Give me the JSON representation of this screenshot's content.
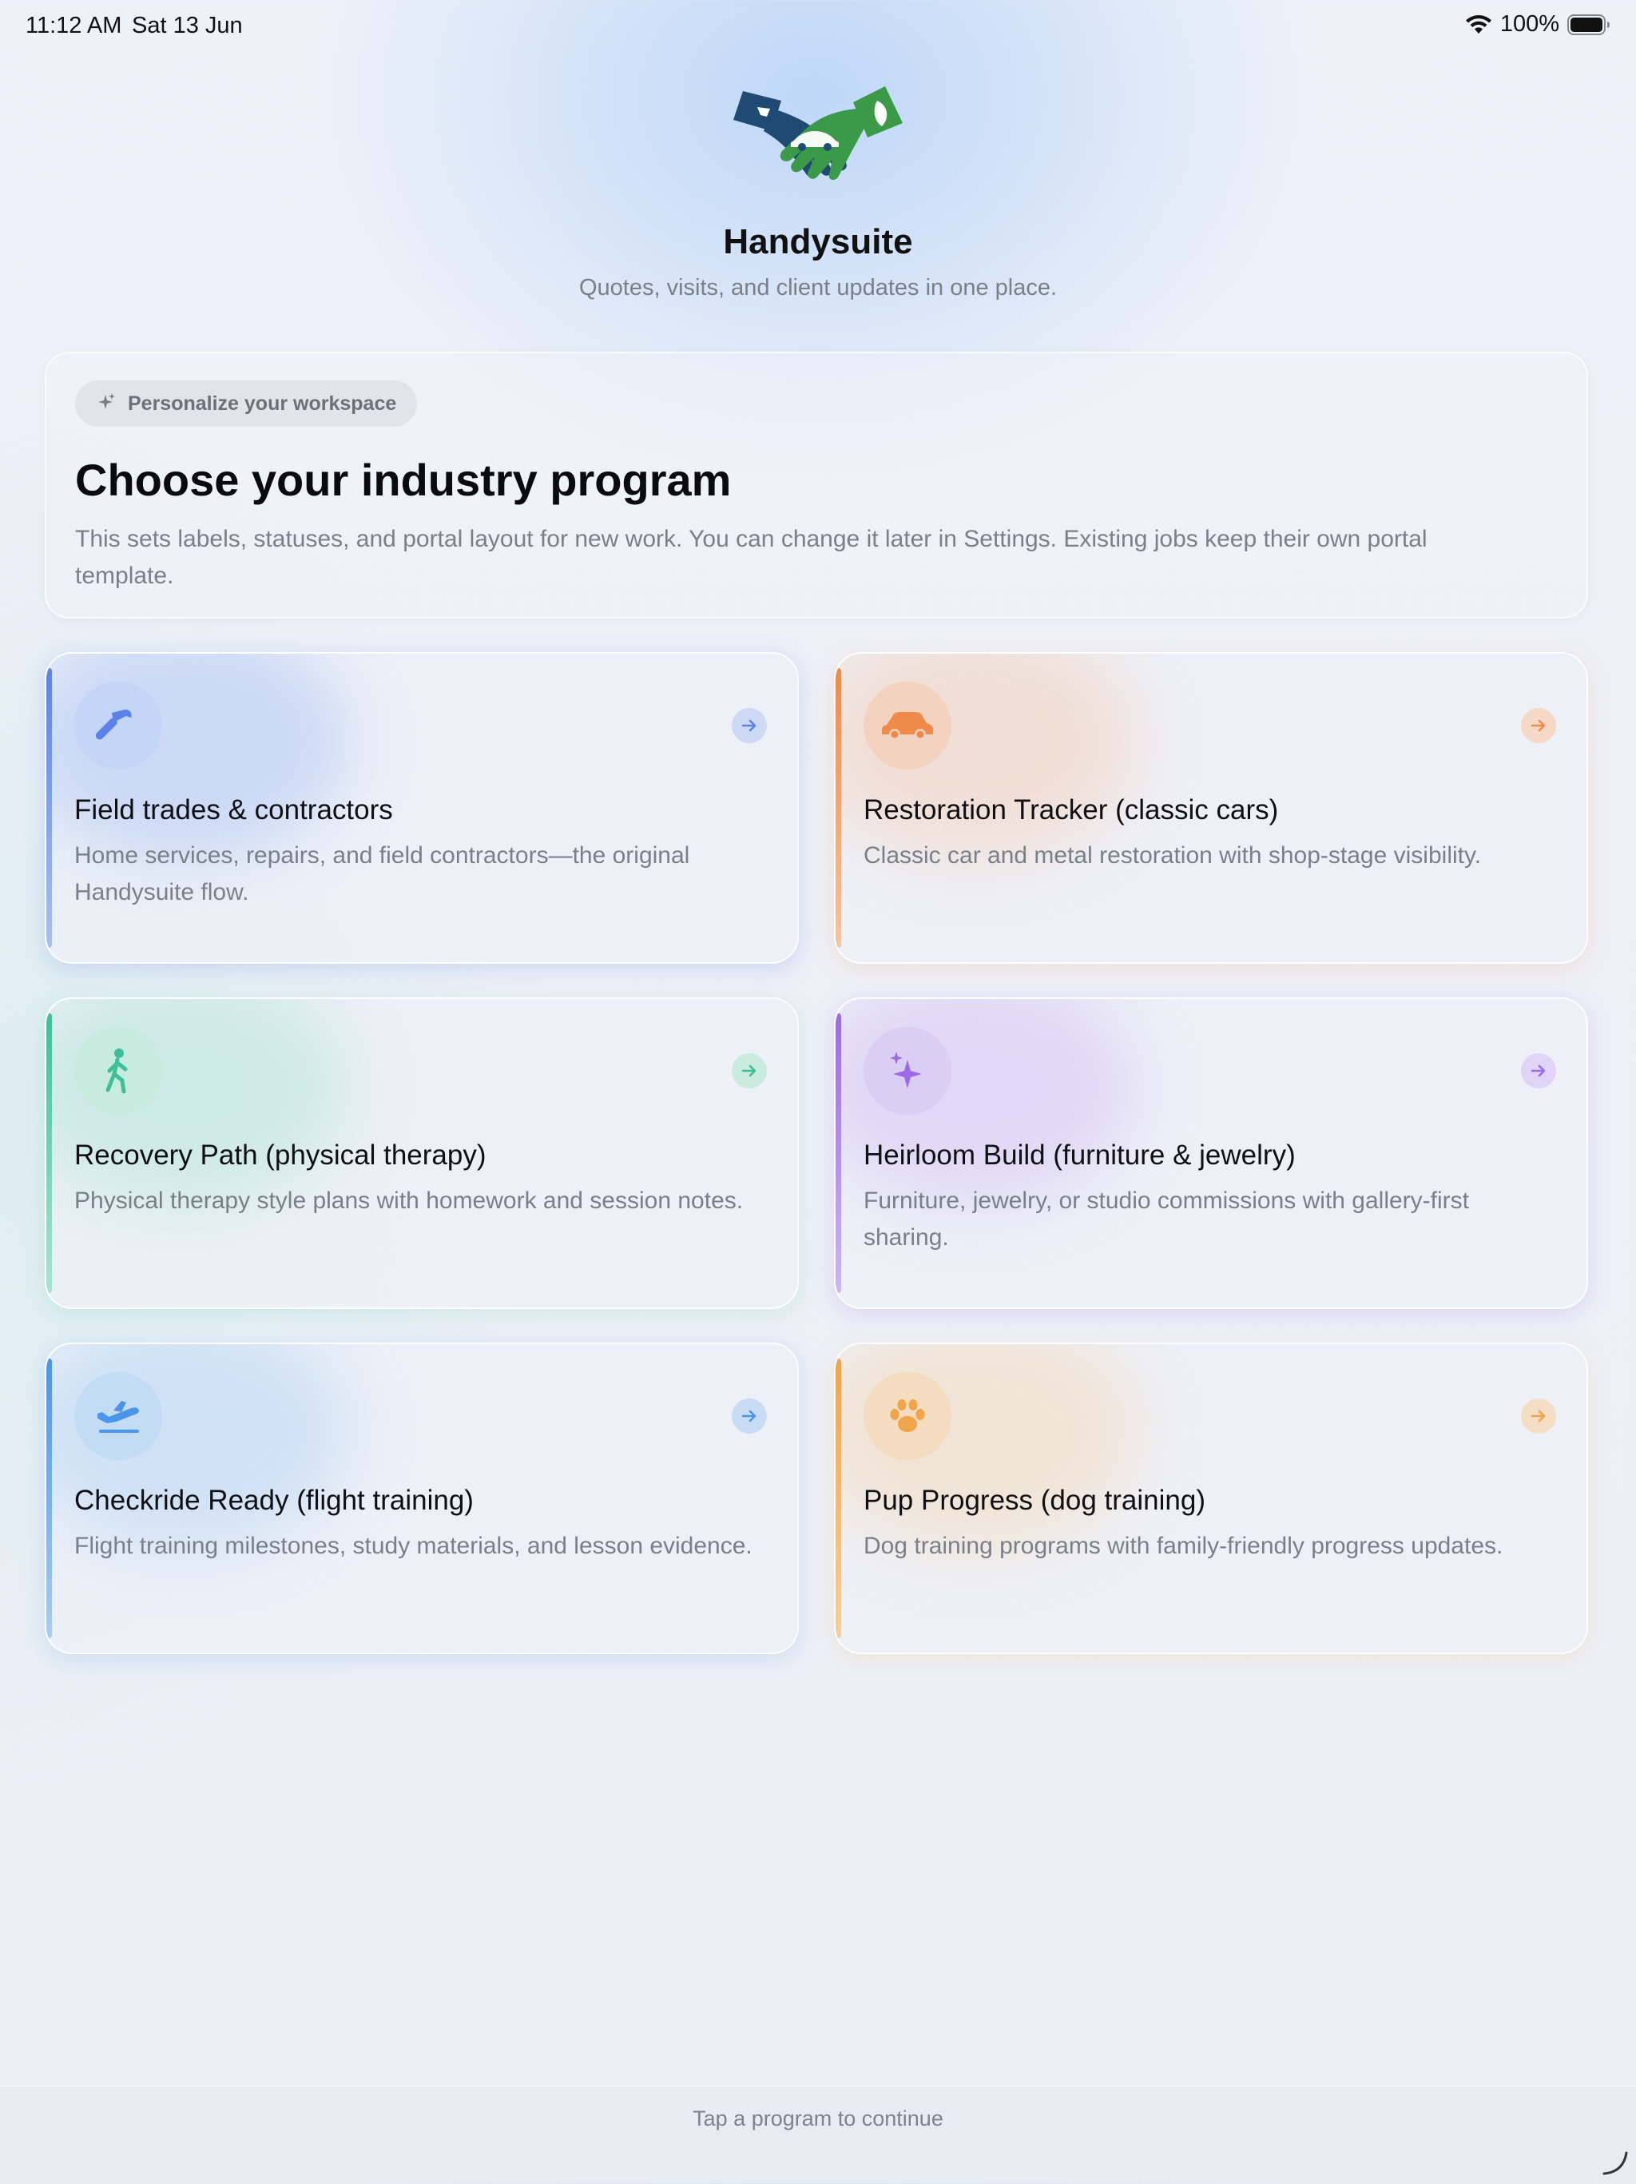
{
  "status_bar": {
    "time": "11:12 AM",
    "date": "Sat 13 Jun",
    "battery": "100%",
    "icons": [
      "wifi-icon",
      "battery-icon"
    ]
  },
  "app": {
    "name": "Handysuite",
    "tagline": "Quotes, visits, and client updates in one place.",
    "logo_icon": "handshake-logo-icon"
  },
  "intro": {
    "pill_label": "Personalize your workspace",
    "pill_icon": "sparkle-icon",
    "title": "Choose your industry program",
    "description": "This sets labels, statuses, and portal layout for new work. You can change it later in Settings. Existing jobs keep their own portal template."
  },
  "programs": [
    {
      "title": "Field trades & contractors",
      "description": "Home services, repairs, and field contractors—the original Handysuite flow.",
      "icon": "hammer-icon",
      "accent": "#5b82ea"
    },
    {
      "title": "Restoration Tracker (classic cars)",
      "description": "Classic car and metal restoration with shop-stage visibility.",
      "icon": "car-icon",
      "accent": "#f08a4b"
    },
    {
      "title": "Recovery Path (physical therapy)",
      "description": "Physical therapy style plans with homework and session notes.",
      "icon": "walking-figure-icon",
      "accent": "#3fbf98"
    },
    {
      "title": "Heirloom Build (furniture & jewelry)",
      "description": "Furniture, jewelry, or studio commissions with gallery-first sharing.",
      "icon": "sparkles-icon",
      "accent": "#9b6be8"
    },
    {
      "title": "Checkride Ready (flight training)",
      "description": "Flight training milestones, study materials, and lesson evidence.",
      "icon": "airplane-takeoff-icon",
      "accent": "#4a95ea"
    },
    {
      "title": "Pup Progress (dog training)",
      "description": "Dog training programs with family-friendly progress updates.",
      "icon": "paw-print-icon",
      "accent": "#f0a54a"
    }
  ],
  "footer": {
    "hint": "Tap a program to continue"
  }
}
